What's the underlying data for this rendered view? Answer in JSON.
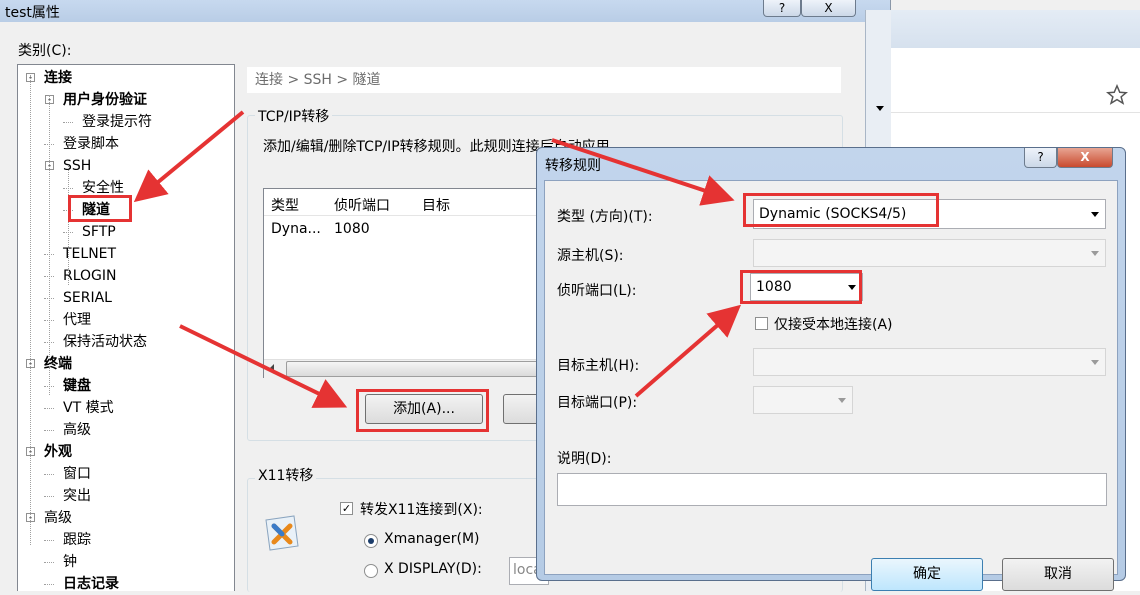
{
  "main": {
    "title": "test属性",
    "help_btn": "?",
    "close_btn": "X",
    "category_label": "类别(C):"
  },
  "tree": [
    {
      "label": "连接",
      "bold": true,
      "toggle": "-"
    },
    {
      "label": "用户身份验证",
      "bold": true,
      "toggle": "-"
    },
    {
      "label": "登录提示符"
    },
    {
      "label": "登录脚本"
    },
    {
      "label": "SSH",
      "toggle": "-"
    },
    {
      "label": "安全性"
    },
    {
      "label": "隧道",
      "bold": true
    },
    {
      "label": "SFTP"
    },
    {
      "label": "TELNET"
    },
    {
      "label": "RLOGIN"
    },
    {
      "label": "SERIAL"
    },
    {
      "label": "代理"
    },
    {
      "label": "保持活动状态"
    },
    {
      "label": "终端",
      "bold": true,
      "toggle": "-"
    },
    {
      "label": "键盘",
      "bold": true
    },
    {
      "label": "VT 模式"
    },
    {
      "label": "高级"
    },
    {
      "label": "外观",
      "bold": true,
      "toggle": "-"
    },
    {
      "label": "窗口"
    },
    {
      "label": "突出"
    },
    {
      "label": "高级",
      "toggle": "-"
    },
    {
      "label": "跟踪"
    },
    {
      "label": "钟"
    },
    {
      "label": "日志记录",
      "bold": true
    }
  ],
  "panel": {
    "breadcrumb": "连接 > SSH > 隧道",
    "tcp_title": "TCP/IP转移",
    "tcp_desc": "添加/编辑/删除TCP/IP转移规则。此规则连接后自动应用",
    "columns": [
      "类型",
      "侦听端口",
      "目标"
    ],
    "row": {
      "type": "Dyna...",
      "port": "1080"
    },
    "add_button": "添加(A)...",
    "x11_title": "X11转移",
    "x11_checkbox": "转发X11连接到(X):",
    "radio_xmanager": "Xmanager(M)",
    "radio_xdisplay": "X DISPLAY(D):",
    "xdisplay_value": "localhost"
  },
  "dialog": {
    "title": "转移规则",
    "help_btn": "?",
    "close_btn": "X",
    "type_label": "类型 (方向)(T):",
    "type_value": "Dynamic (SOCKS4/5)",
    "source_label": "源主机(S):",
    "listen_label": "侦听端口(L):",
    "listen_value": "1080",
    "local_only": "仅接受本地连接(A)",
    "target_host_label": "目标主机(H):",
    "target_port_label": "目标端口(P):",
    "desc_label": "说明(D):",
    "ok": "确定",
    "cancel": "取消"
  },
  "colors": {
    "annotation": "#e53333",
    "accent": "#3c7fb1"
  }
}
